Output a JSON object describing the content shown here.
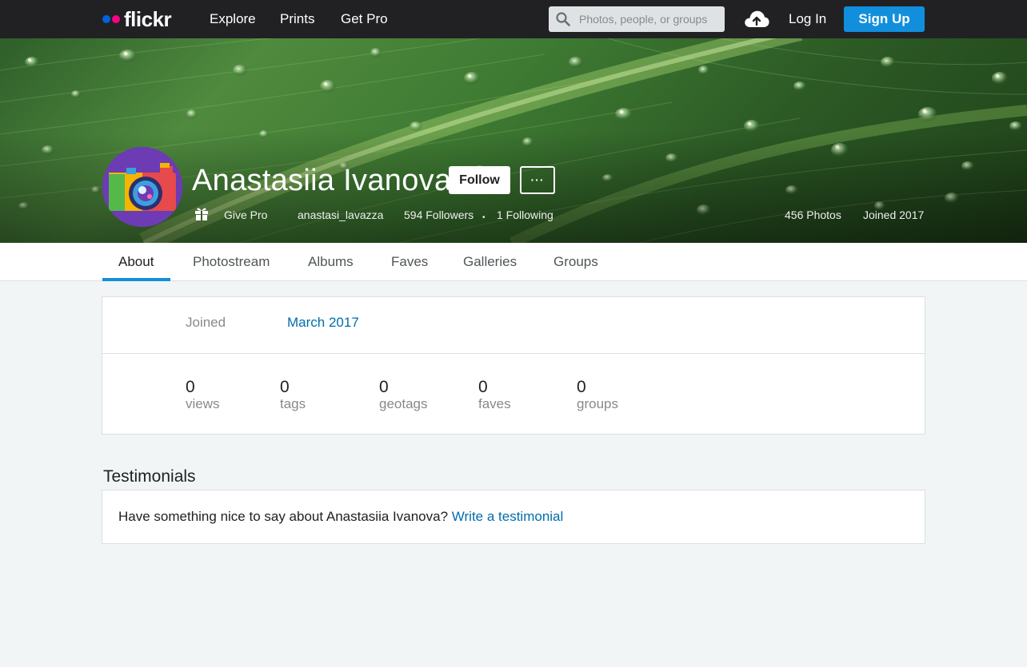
{
  "topnav": {
    "logo_text": "flickr",
    "links": [
      "Explore",
      "Prints",
      "Get Pro"
    ],
    "search_placeholder": "Photos, people, or groups",
    "upload_icon": "cloud-upload-icon",
    "login_label": "Log In",
    "signup_label": "Sign Up"
  },
  "colors": {
    "nav_bg": "#212124",
    "accent_blue": "#128fdc",
    "link_blue": "#006dac",
    "logo_blue": "#0063dc",
    "logo_pink": "#ff0084"
  },
  "profile": {
    "real_name": "Anastasiia Ivanova",
    "follow_label": "Follow",
    "more_label": "···",
    "give_pro_label": "Give Pro",
    "username": "anastasi_lavazza",
    "followers": "594 Followers",
    "separator": "•",
    "following": "1 Following",
    "photos": "456 Photos",
    "joined_year": "Joined 2017"
  },
  "subnav": {
    "tabs": [
      "About",
      "Photostream",
      "Albums",
      "Faves",
      "Galleries",
      "Groups"
    ]
  },
  "about": {
    "joined_label": "Joined",
    "joined_value": "March 2017",
    "stats": [
      {
        "value": "0",
        "label": "views"
      },
      {
        "value": "0",
        "label": "tags"
      },
      {
        "value": "0",
        "label": "geotags"
      },
      {
        "value": "0",
        "label": "faves"
      },
      {
        "value": "0",
        "label": "groups"
      }
    ]
  },
  "testimonials": {
    "title": "Testimonials",
    "prompt": "Have something nice to say about Anastasiia Ivanova?",
    "link_label": "Write a testimonial"
  }
}
